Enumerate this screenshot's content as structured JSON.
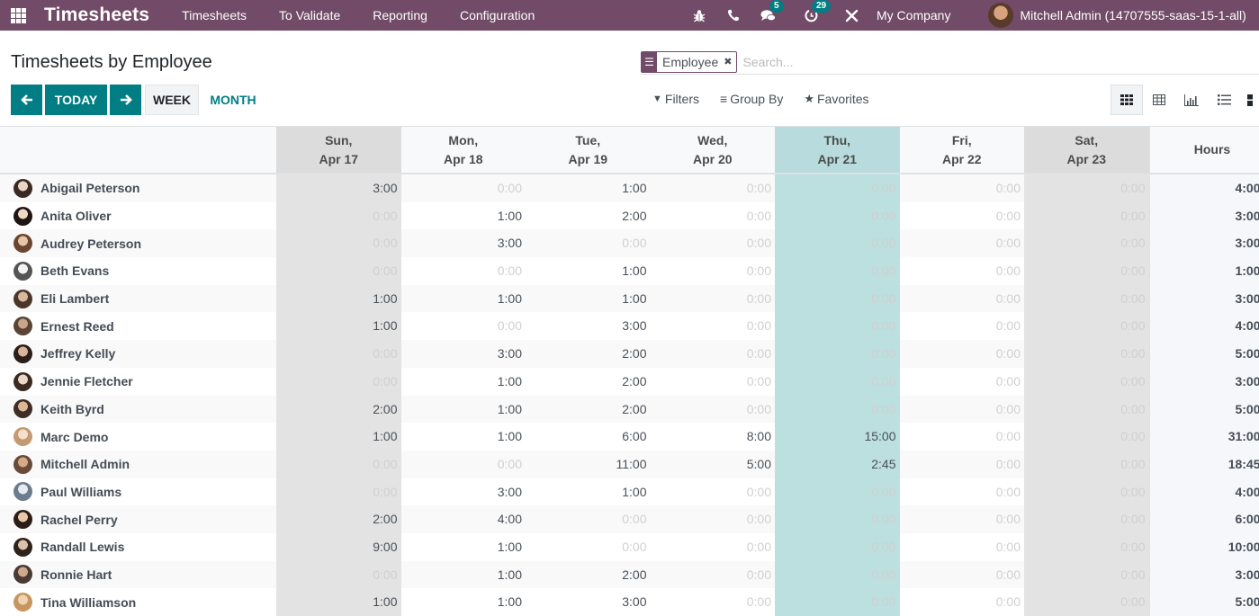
{
  "navbar": {
    "app_name": "Timesheets",
    "menu": [
      "Timesheets",
      "To Validate",
      "Reporting",
      "Configuration"
    ],
    "icons": {
      "debug": "bug-icon",
      "phone": "phone-icon",
      "messages": "chat-icon",
      "activities": "clock-icon",
      "tools": "tools-icon"
    },
    "messages_badge": "5",
    "activities_badge": "29",
    "company": "My Company",
    "user": "Mitchell Admin (14707555-saas-15-1-all)"
  },
  "page": {
    "title": "Timesheets by Employee"
  },
  "search": {
    "facet_label": "Employee",
    "placeholder": "Search...",
    "value": ""
  },
  "controls": {
    "prev_icon": "arrow-left-icon",
    "today_label": "TODAY",
    "next_icon": "arrow-right-icon",
    "week_label": "WEEK",
    "month_label": "MONTH",
    "filters_label": "Filters",
    "group_by_label": "Group By",
    "favorites_label": "Favorites"
  },
  "views": [
    "grid-view",
    "pivot-view",
    "graph-view",
    "list-view",
    "kanban-view"
  ],
  "colors": {
    "brand": "#714b67",
    "primary": "#017e84",
    "today_column": "#b8dcdd",
    "weekend_column": "#dcdcdc"
  },
  "grid": {
    "columns": [
      {
        "day": "Sun,",
        "date": "Apr 17",
        "type": "weekend"
      },
      {
        "day": "Mon,",
        "date": "Apr 18",
        "type": "normal"
      },
      {
        "day": "Tue,",
        "date": "Apr 19",
        "type": "normal"
      },
      {
        "day": "Wed,",
        "date": "Apr 20",
        "type": "normal"
      },
      {
        "day": "Thu,",
        "date": "Apr 21",
        "type": "today"
      },
      {
        "day": "Fri,",
        "date": "Apr 22",
        "type": "normal"
      },
      {
        "day": "Sat,",
        "date": "Apr 23",
        "type": "weekend"
      }
    ],
    "total_header": "Hours",
    "rows": [
      {
        "name": "Abigail Peterson",
        "values": [
          "3:00",
          "0:00",
          "1:00",
          "0:00",
          "0:00",
          "0:00",
          "0:00"
        ],
        "total": "4:00"
      },
      {
        "name": "Anita Oliver",
        "values": [
          "0:00",
          "1:00",
          "2:00",
          "0:00",
          "0:00",
          "0:00",
          "0:00"
        ],
        "total": "3:00"
      },
      {
        "name": "Audrey Peterson",
        "values": [
          "0:00",
          "3:00",
          "0:00",
          "0:00",
          "0:00",
          "0:00",
          "0:00"
        ],
        "total": "3:00"
      },
      {
        "name": "Beth Evans",
        "values": [
          "0:00",
          "0:00",
          "1:00",
          "0:00",
          "0:00",
          "0:00",
          "0:00"
        ],
        "total": "1:00"
      },
      {
        "name": "Eli Lambert",
        "values": [
          "1:00",
          "1:00",
          "1:00",
          "0:00",
          "0:00",
          "0:00",
          "0:00"
        ],
        "total": "3:00"
      },
      {
        "name": "Ernest Reed",
        "values": [
          "1:00",
          "0:00",
          "3:00",
          "0:00",
          "0:00",
          "0:00",
          "0:00"
        ],
        "total": "4:00"
      },
      {
        "name": "Jeffrey Kelly",
        "values": [
          "0:00",
          "3:00",
          "2:00",
          "0:00",
          "0:00",
          "0:00",
          "0:00"
        ],
        "total": "5:00"
      },
      {
        "name": "Jennie Fletcher",
        "values": [
          "0:00",
          "1:00",
          "2:00",
          "0:00",
          "0:00",
          "0:00",
          "0:00"
        ],
        "total": "3:00"
      },
      {
        "name": "Keith Byrd",
        "values": [
          "2:00",
          "1:00",
          "2:00",
          "0:00",
          "0:00",
          "0:00",
          "0:00"
        ],
        "total": "5:00"
      },
      {
        "name": "Marc Demo",
        "values": [
          "1:00",
          "1:00",
          "6:00",
          "8:00",
          "15:00",
          "0:00",
          "0:00"
        ],
        "total": "31:00"
      },
      {
        "name": "Mitchell Admin",
        "values": [
          "0:00",
          "0:00",
          "11:00",
          "5:00",
          "2:45",
          "0:00",
          "0:00"
        ],
        "total": "18:45"
      },
      {
        "name": "Paul Williams",
        "values": [
          "0:00",
          "3:00",
          "1:00",
          "0:00",
          "0:00",
          "0:00",
          "0:00"
        ],
        "total": "4:00"
      },
      {
        "name": "Rachel Perry",
        "values": [
          "2:00",
          "4:00",
          "0:00",
          "0:00",
          "0:00",
          "0:00",
          "0:00"
        ],
        "total": "6:00"
      },
      {
        "name": "Randall Lewis",
        "values": [
          "9:00",
          "1:00",
          "0:00",
          "0:00",
          "0:00",
          "0:00",
          "0:00"
        ],
        "total": "10:00"
      },
      {
        "name": "Ronnie Hart",
        "values": [
          "0:00",
          "1:00",
          "2:00",
          "0:00",
          "0:00",
          "0:00",
          "0:00"
        ],
        "total": "3:00"
      },
      {
        "name": "Tina Williamson",
        "values": [
          "1:00",
          "1:00",
          "3:00",
          "0:00",
          "0:00",
          "0:00",
          "0:00"
        ],
        "total": "5:00"
      }
    ]
  }
}
